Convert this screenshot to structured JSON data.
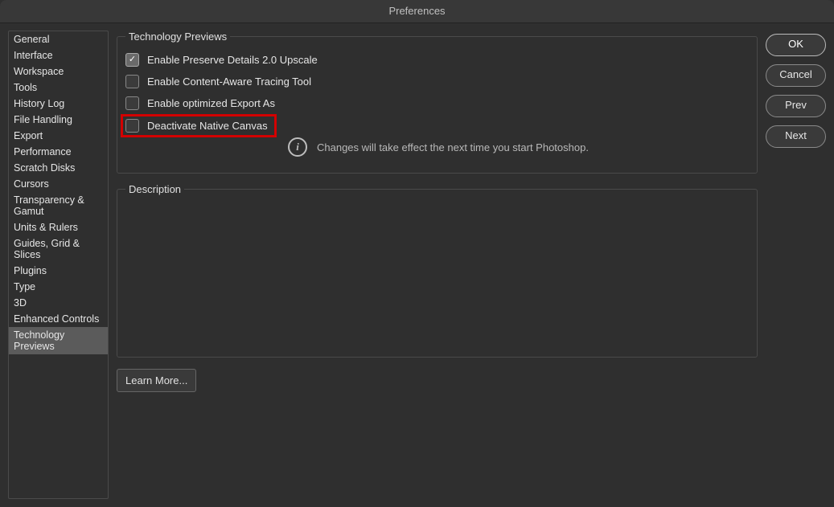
{
  "window": {
    "title": "Preferences"
  },
  "sidebar": {
    "items": [
      {
        "label": "General"
      },
      {
        "label": "Interface"
      },
      {
        "label": "Workspace"
      },
      {
        "label": "Tools"
      },
      {
        "label": "History Log"
      },
      {
        "label": "File Handling"
      },
      {
        "label": "Export"
      },
      {
        "label": "Performance"
      },
      {
        "label": "Scratch Disks"
      },
      {
        "label": "Cursors"
      },
      {
        "label": "Transparency & Gamut"
      },
      {
        "label": "Units & Rulers"
      },
      {
        "label": "Guides, Grid & Slices"
      },
      {
        "label": "Plugins"
      },
      {
        "label": "Type"
      },
      {
        "label": "3D"
      },
      {
        "label": "Enhanced Controls"
      },
      {
        "label": "Technology Previews"
      }
    ],
    "selected_index": 17
  },
  "main": {
    "group_title": "Technology Previews",
    "options": [
      {
        "label": "Enable Preserve Details 2.0 Upscale",
        "checked": true
      },
      {
        "label": "Enable Content-Aware Tracing Tool",
        "checked": false
      },
      {
        "label": "Enable optimized Export As",
        "checked": false
      },
      {
        "label": "Deactivate Native Canvas",
        "checked": false
      }
    ],
    "info_text": "Changes will take effect the next time you start Photoshop.",
    "description_title": "Description",
    "learn_more": "Learn More..."
  },
  "actions": {
    "ok": "OK",
    "cancel": "Cancel",
    "prev": "Prev",
    "next": "Next"
  }
}
